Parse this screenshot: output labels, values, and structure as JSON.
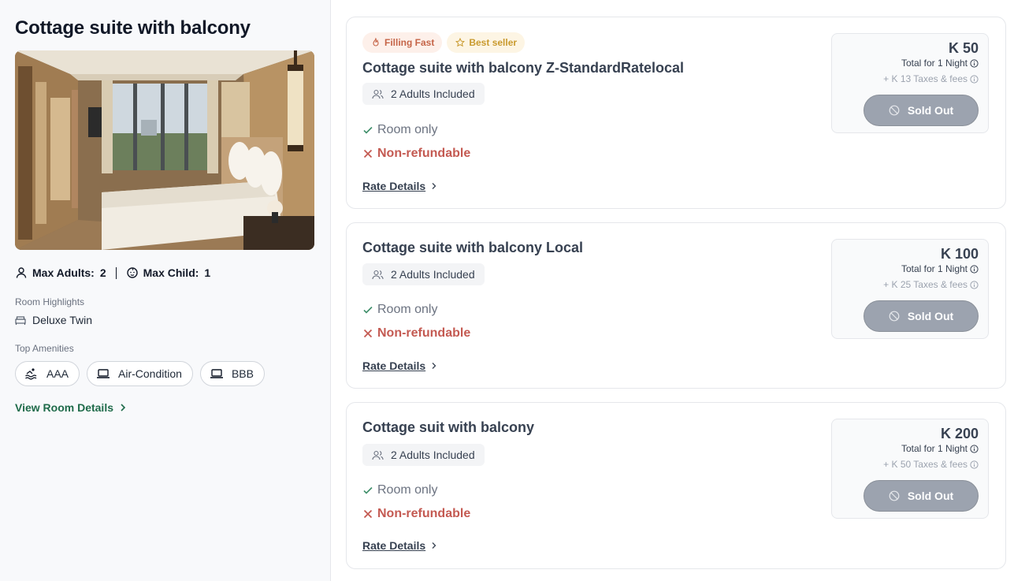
{
  "room": {
    "title": "Cottage suite with balcony",
    "max_adults_label": "Max Adults:",
    "max_adults_value": "2",
    "max_child_label": "Max Child:",
    "max_child_value": "1",
    "highlights_label": "Room Highlights",
    "highlight": "Deluxe Twin",
    "amenities_label": "Top Amenities",
    "amenities": [
      "AAA",
      "Air-Condition",
      "BBB"
    ],
    "view_details": "View Room Details"
  },
  "badges": {
    "filling_fast": "Filling Fast",
    "best_seller": "Best seller"
  },
  "rates": [
    {
      "title": "Cottage suite with balcony Z-StandardRatelocal",
      "adults": "2 Adults Included",
      "inclusion": "Room only",
      "refund": "Non-refundable",
      "details": "Rate Details",
      "price": "K 50",
      "per_night": "Total for 1 Night",
      "taxes": "+ K 13 Taxes & fees",
      "button": "Sold Out"
    },
    {
      "title": "Cottage suite with balcony Local",
      "adults": "2 Adults Included",
      "inclusion": "Room only",
      "refund": "Non-refundable",
      "details": "Rate Details",
      "price": "K 100",
      "per_night": "Total for 1 Night",
      "taxes": "+ K 25 Taxes & fees",
      "button": "Sold Out"
    },
    {
      "title": "Cottage suit with balcony",
      "adults": "2 Adults Included",
      "inclusion": "Room only",
      "refund": "Non-refundable",
      "details": "Rate Details",
      "price": "K 200",
      "per_night": "Total for 1 Night",
      "taxes": "+ K 50 Taxes & fees",
      "button": "Sold Out"
    }
  ],
  "colors": {
    "accent_green": "#1f6b4a",
    "refund_red": "#c45a52",
    "sold_out_gray": "#9ca3af"
  },
  "icons": {
    "adult": "person-icon",
    "child": "child-face-icon",
    "bed": "bed-icon",
    "pool": "pool-icon",
    "laptop": "laptop-icon",
    "fire": "flame-icon",
    "star": "star-icon",
    "users": "users-icon",
    "check": "check-icon",
    "cross": "x-icon",
    "chevron": "chevron-right-icon",
    "info": "info-icon",
    "ban": "ban-icon"
  }
}
